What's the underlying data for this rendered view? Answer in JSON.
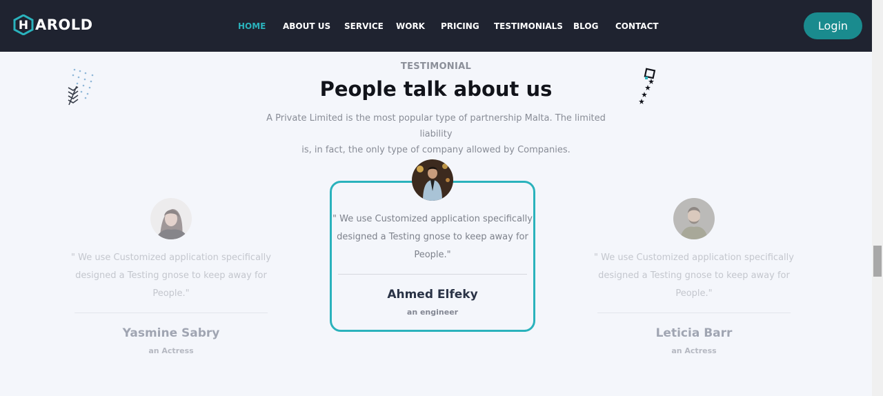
{
  "brand": {
    "logo_letter": "H",
    "logo_rest": "AROLD"
  },
  "nav": {
    "items": [
      {
        "label": "HOME",
        "active": true
      },
      {
        "label": "ABOUT US",
        "active": false
      },
      {
        "label": "SERVICE",
        "active": false
      },
      {
        "label": "WORK",
        "active": false
      },
      {
        "label": "PRICING",
        "active": false
      },
      {
        "label": "TESTIMONIALS",
        "active": false
      },
      {
        "label": "BLOG",
        "active": false
      },
      {
        "label": "CONTACT",
        "active": false
      }
    ],
    "login_label": "Login"
  },
  "section": {
    "eyebrow": "TESTIMONIAL",
    "title": "People talk about us",
    "subtitle_line1": "A Private Limited is the most popular type of partnership Malta. The limited liability",
    "subtitle_line2": "is, in fact, the only type of company allowed by Companies."
  },
  "testimonials": [
    {
      "quote_line1": "\" We use Customized application specifically",
      "quote_line2": "designed a Testing gnose to keep away for",
      "quote_line3": "People.\"",
      "name": "Yasmine Sabry",
      "role": "an Actress"
    },
    {
      "quote_line1": "\" We use Customized application specifically",
      "quote_line2": "designed a Testing gnose to keep away for",
      "quote_line3": "People.\"",
      "name": "Ahmed Elfeky",
      "role": "an engineer"
    },
    {
      "quote_line1": "\" We use Customized application specifically",
      "quote_line2": "designed a Testing gnose to keep away for",
      "quote_line3": "People.\"",
      "name": "Leticia Barr",
      "role": "an Actress"
    }
  ],
  "colors": {
    "accent": "#2ab2bc",
    "nav_bg": "#1f2330",
    "login_bg": "#1a8b8e",
    "page_bg": "#f4f6fb"
  },
  "icons": {
    "logo": "hexagon-logo-icon",
    "deco_left": "dots-chevron-decoration",
    "deco_right": "stars-decoration"
  }
}
